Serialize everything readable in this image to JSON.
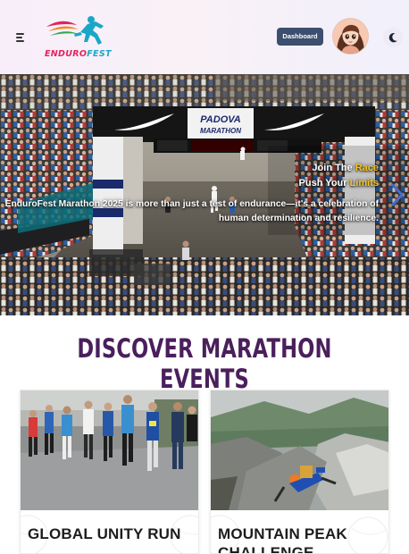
{
  "header": {
    "logo_text_part1": "ENDURO",
    "logo_text_part2": "FEST",
    "dashboard_label": "Dashboard",
    "icons": {
      "menu": "hamburger-menu-icon",
      "theme": "moon-icon",
      "avatar": "user-avatar"
    }
  },
  "hero": {
    "line1_prefix": "Join The ",
    "line1_accent": "Race",
    "line2_prefix": "Push Your ",
    "line2_accent": "Limits",
    "description": "EnduroFest Marathon 2025 is more than just a test of endurance—it's a celebration of human determination and resilience.",
    "next_icon": "chevron-right-icon"
  },
  "events": {
    "title": "DISCOVER MARATHON EVENTS",
    "cards": [
      {
        "title": "GLOBAL UNITY RUN"
      },
      {
        "title": "MOUNTAIN PEAK CHALLENGE"
      }
    ]
  },
  "colors": {
    "accent": "#f5c518",
    "title_purple": "#4a1f5c",
    "dashboard_button": "#3c4f6f",
    "header_bg": "#f7eefa"
  }
}
